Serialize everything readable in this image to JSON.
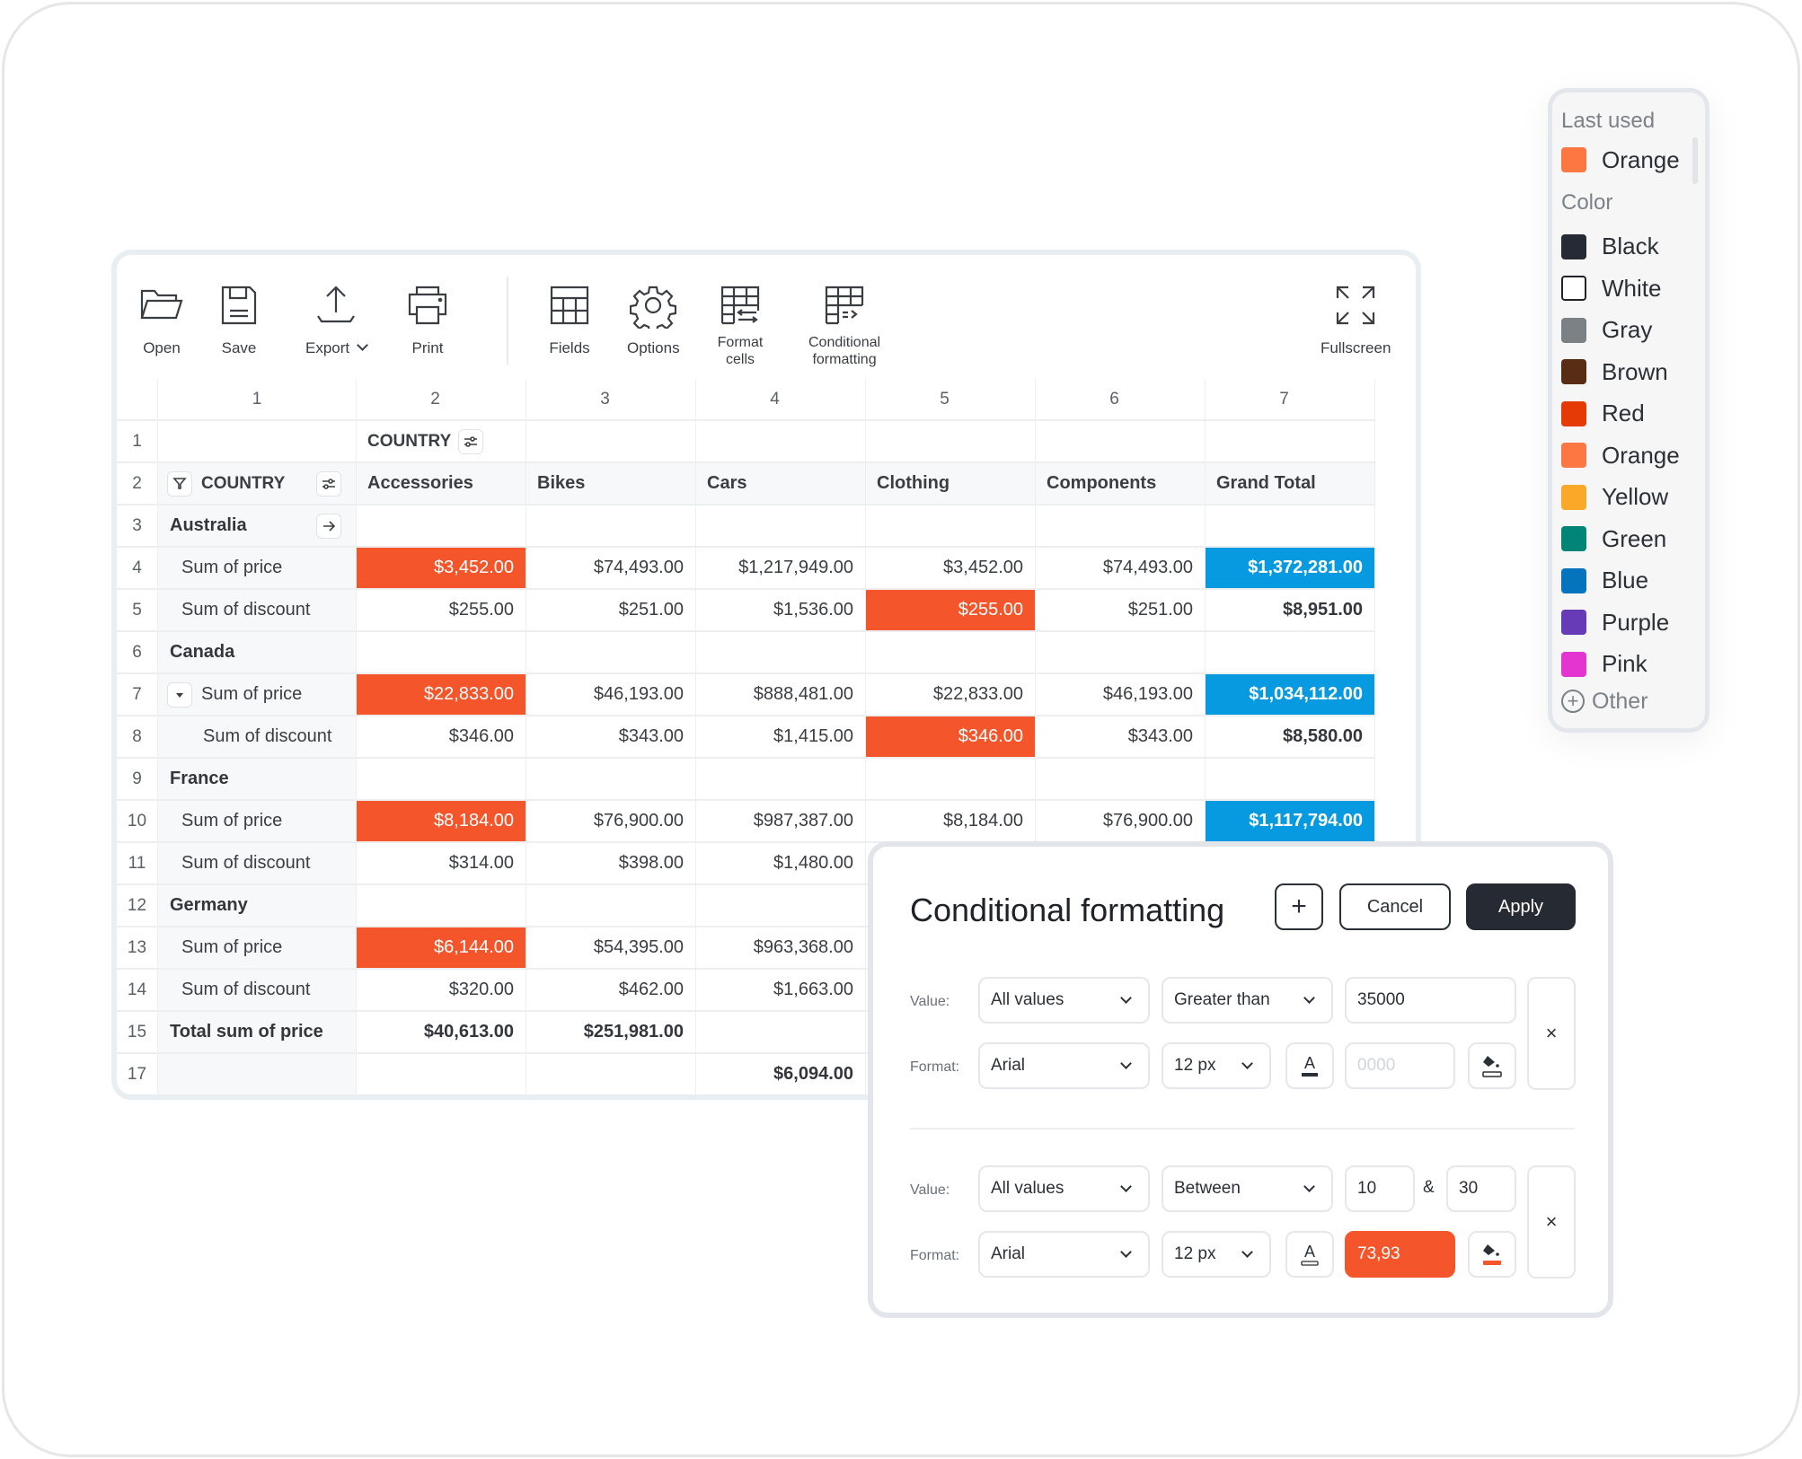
{
  "toolbar": {
    "open": "Open",
    "save": "Save",
    "export": "Export",
    "print": "Print",
    "fields": "Fields",
    "options": "Options",
    "format_cells_1": "Format",
    "format_cells_2": "cells",
    "conditional_1": "Conditional",
    "conditional_2": "formatting",
    "fullscreen": "Fullscreen"
  },
  "grid": {
    "column_numbers": [
      "1",
      "2",
      "3",
      "4",
      "5",
      "6",
      "7"
    ],
    "row1": {
      "num": "1",
      "column_field": "COUNTRY"
    },
    "row2": {
      "num": "2",
      "row_field": "COUNTRY",
      "columns": [
        "Accessories",
        "Bikes",
        "Cars",
        "Clothing",
        "Components",
        "Grand Total"
      ]
    },
    "rows": [
      {
        "num": "3",
        "label": "Australia",
        "type": "group"
      },
      {
        "num": "4",
        "label": "Sum of price",
        "type": "measure",
        "values": [
          "$3,452.00",
          "$74,493.00",
          "$1,217,949.00",
          "$3,452.00",
          "$74,493.00",
          "$1,372,281.00"
        ]
      },
      {
        "num": "5",
        "label": "Sum of discount",
        "type": "measure",
        "values": [
          "$255.00",
          "$251.00",
          "$1,536.00",
          "$255.00",
          "$251.00",
          "$8,951.00"
        ]
      },
      {
        "num": "6",
        "label": "Canada",
        "type": "group"
      },
      {
        "num": "7",
        "label": "Sum of price",
        "type": "measure",
        "values": [
          "$22,833.00",
          "$46,193.00",
          "$888,481.00",
          "$22,833.00",
          "$46,193.00",
          "$1,034,112.00"
        ]
      },
      {
        "num": "8",
        "label": "Sum of discount",
        "type": "measure",
        "values": [
          "$346.00",
          "$343.00",
          "$1,415.00",
          "$346.00",
          "$343.00",
          "$8,580.00"
        ]
      },
      {
        "num": "9",
        "label": "France",
        "type": "group"
      },
      {
        "num": "10",
        "label": "Sum of price",
        "type": "measure",
        "values": [
          "$8,184.00",
          "$76,900.00",
          "$987,387.00",
          "$8,184.00",
          "$76,900.00",
          "$1,117,794.00"
        ]
      },
      {
        "num": "11",
        "label": "Sum of discount",
        "type": "measure",
        "values": [
          "$314.00",
          "$398.00",
          "$1,480.00"
        ]
      },
      {
        "num": "12",
        "label": "Germany",
        "type": "group"
      },
      {
        "num": "13",
        "label": "Sum of price",
        "type": "measure",
        "values": [
          "$6,144.00",
          "$54,395.00",
          "$963,368.00"
        ]
      },
      {
        "num": "14",
        "label": "Sum of discount",
        "type": "measure",
        "values": [
          "$320.00",
          "$462.00",
          "$1,663.00"
        ]
      },
      {
        "num": "15",
        "label": "Total sum of price",
        "type": "total",
        "values": [
          "$40,613.00",
          "$251,981.00",
          ""
        ]
      },
      {
        "num": "17",
        "label": "",
        "type": "total",
        "values": [
          "",
          "",
          "$6,094.00"
        ]
      }
    ]
  },
  "colors": {
    "highlight_orange": "#f4552a",
    "highlight_blue": "#079ae0"
  },
  "picker": {
    "last_used_label": "Last used",
    "last_used": [
      {
        "name": "Orange",
        "hex": "#fd7742"
      }
    ],
    "color_label": "Color",
    "colors": [
      {
        "name": "Black",
        "hex": "#262a35"
      },
      {
        "name": "White",
        "hex": "#ffffff"
      },
      {
        "name": "Gray",
        "hex": "#7c8185"
      },
      {
        "name": "Brown",
        "hex": "#582d14"
      },
      {
        "name": "Red",
        "hex": "#e63a05"
      },
      {
        "name": "Orange",
        "hex": "#fd7742"
      },
      {
        "name": "Yellow",
        "hex": "#f9a828"
      },
      {
        "name": "Green",
        "hex": "#008576"
      },
      {
        "name": "Blue",
        "hex": "#0374bd"
      },
      {
        "name": "Purple",
        "hex": "#673ab7"
      },
      {
        "name": "Pink",
        "hex": "#e535d0"
      }
    ],
    "other_label": "Other"
  },
  "dialog": {
    "title": "Conditional formatting",
    "add_label": "+",
    "cancel_label": "Cancel",
    "apply_label": "Apply",
    "value_label": "Value:",
    "format_label": "Format:",
    "rules": [
      {
        "field": "All values",
        "condition": "Greater than",
        "value": "35000",
        "font": "Arial",
        "size": "12 px",
        "color_value": "",
        "color_placeholder": "0000",
        "remove": "×"
      },
      {
        "field": "All values",
        "condition": "Between",
        "value_from": "10",
        "and": "&",
        "value_to": "30",
        "font": "Arial",
        "size": "12 px",
        "color_value": "73,93",
        "remove": "×"
      }
    ]
  }
}
